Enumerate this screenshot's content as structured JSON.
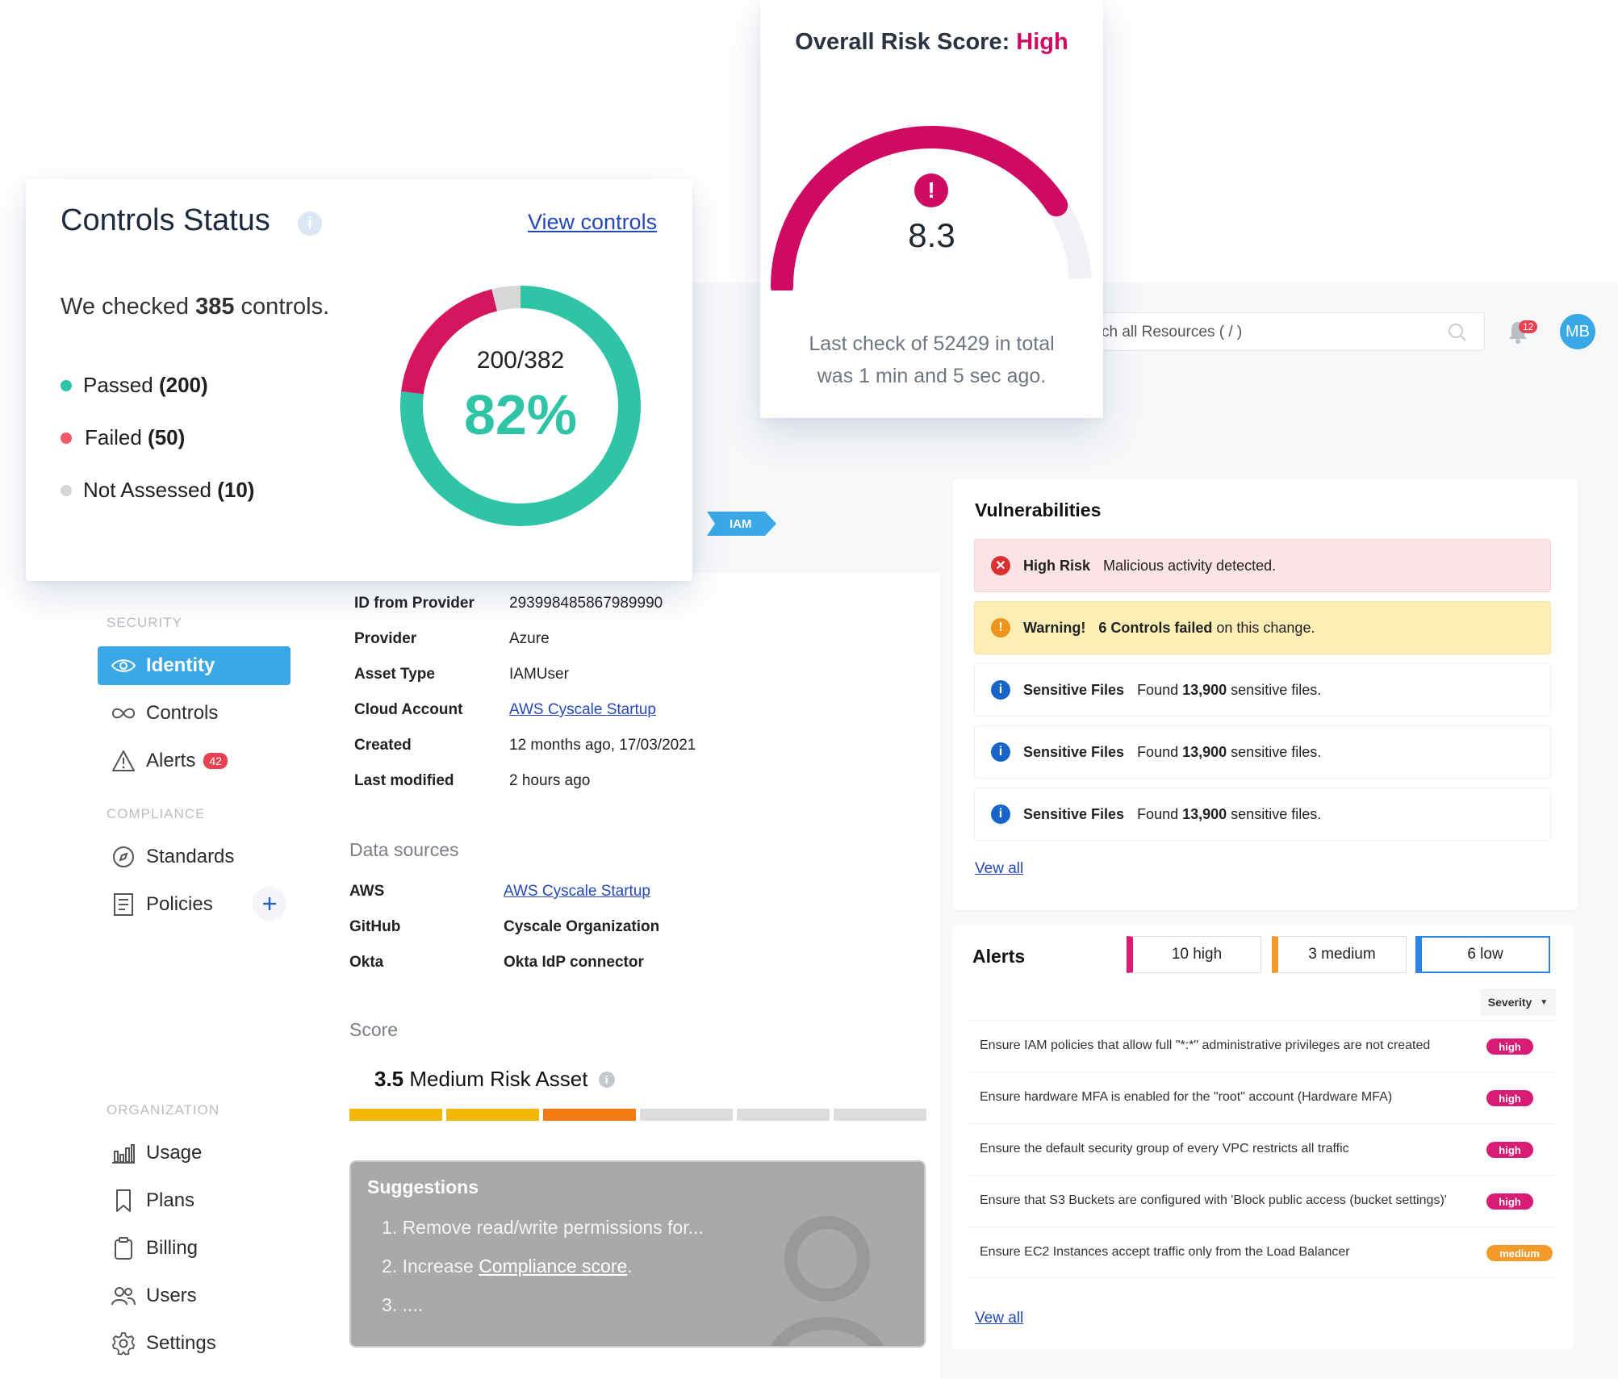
{
  "controls": {
    "title": "Controls Status",
    "view_link": "View controls",
    "checked_pre": "We checked ",
    "checked_count": "385",
    "checked_post": " controls.",
    "legend": [
      {
        "label": "Passed ",
        "count": "(200)",
        "color": "#2fc4a6"
      },
      {
        "label": "Failed ",
        "count": "(50)",
        "color": "#ee5a68"
      },
      {
        "label": "Not Assessed ",
        "count": "(10)",
        "color": "#d7d7d7"
      }
    ],
    "ratio": "200/382",
    "percent": "82%",
    "donut": {
      "passed": 200,
      "failed": 50,
      "not_assessed": 10
    }
  },
  "risk": {
    "title_pre": "Overall Risk Score: ",
    "level": "High",
    "score": "8.3",
    "score_value": 8.3,
    "score_max": 10,
    "line1": "Last check of 52429 in total",
    "line2": "was 1 min and 5 sec ago.",
    "color": "#cf0a63"
  },
  "topbar": {
    "search_placeholder": "ch all Resources ( / )",
    "notif_count": "12",
    "avatar": "MB"
  },
  "tag": "IAM",
  "sidebar": {
    "security_heading": "SECURITY",
    "security_items": [
      {
        "label": "Identity",
        "icon": "eye-icon",
        "active": true
      },
      {
        "label": "Controls",
        "icon": "infinity-icon"
      },
      {
        "label": "Alerts",
        "icon": "warning-icon",
        "badge": "42"
      }
    ],
    "compliance_heading": "COMPLIANCE",
    "compliance_items": [
      {
        "label": "Standards",
        "icon": "compass-icon"
      },
      {
        "label": "Policies",
        "icon": "document-icon"
      }
    ],
    "organization_heading": "ORGANIZATION",
    "organization_items": [
      {
        "label": "Usage",
        "icon": "bar-chart-icon"
      },
      {
        "label": "Plans",
        "icon": "bookmark-icon"
      },
      {
        "label": "Billing",
        "icon": "clipboard-icon"
      },
      {
        "label": "Users",
        "icon": "users-icon"
      },
      {
        "label": "Settings",
        "icon": "gear-icon"
      }
    ]
  },
  "details": {
    "rows": [
      {
        "k": "ID from Provider",
        "v": "293998485867989990"
      },
      {
        "k": "Provider",
        "v": "Azure"
      },
      {
        "k": "Asset Type",
        "v": "IAMUser"
      },
      {
        "k": "Cloud Account",
        "v": "AWS Cyscale Startup",
        "link": true
      },
      {
        "k": "Created",
        "v": "12 months ago, 17/03/2021"
      },
      {
        "k": "Last modified",
        "v": "2 hours ago"
      }
    ],
    "data_sources_title": "Data sources",
    "data_sources": [
      {
        "k": "AWS",
        "v": "AWS Cyscale Startup",
        "link": true
      },
      {
        "k": "GitHub",
        "v": "Cyscale Organization"
      },
      {
        "k": "Okta",
        "v": "Okta IdP connector"
      }
    ],
    "score_title": "Score",
    "score_value": "3.5",
    "score_label": " Medium Risk Asset",
    "score_segments": [
      "#f2b705",
      "#f2b705",
      "#f57c12",
      "#dcdcdc",
      "#dcdcdc",
      "#dcdcdc"
    ]
  },
  "suggestions": {
    "title": "Suggestions",
    "item1": "1. Remove read/write permissions for...",
    "item2_pre": "2. Increase ",
    "item2_link": "Compliance score",
    "item2_post": ".",
    "item3": "3. ...."
  },
  "vulnerabilities": {
    "title": "Vulnerabilities",
    "rows": [
      {
        "label": "High Risk",
        "text": "Malicious activity detected.",
        "kind": "error"
      },
      {
        "label": "Warning!",
        "bold": "6 Controls failed",
        "text": " on this change.",
        "kind": "warning"
      },
      {
        "label": "Sensitive Files",
        "pre": "Found ",
        "bold": "13,900",
        "text": " sensitive files.",
        "kind": "info"
      },
      {
        "label": "Sensitive Files",
        "pre": "Found ",
        "bold": "13,900",
        "text": " sensitive files.",
        "kind": "info"
      },
      {
        "label": "Sensitive Files",
        "pre": "Found ",
        "bold": "13,900",
        "text": " sensitive files.",
        "kind": "info"
      }
    ],
    "view_all": "Vew all"
  },
  "alerts": {
    "title": "Alerts",
    "high": "10 high",
    "medium": "3 medium",
    "low": "6 low",
    "severity": "Severity",
    "rows": [
      {
        "text": "Ensure IAM policies that allow full \"*:*\" administrative privileges are not created",
        "sev": "high"
      },
      {
        "text": "Ensure hardware MFA is enabled for the \"root\" account (Hardware MFA)",
        "sev": "high"
      },
      {
        "text": "Ensure the default security group of every VPC restricts all traffic",
        "sev": "high"
      },
      {
        "text": "Ensure that S3 Buckets are configured with 'Block public access (bucket settings)'",
        "sev": "high"
      },
      {
        "text": "Ensure EC2 Instances accept traffic only from the Load Balancer",
        "sev": "medium"
      }
    ],
    "view_all": "Vew all"
  }
}
